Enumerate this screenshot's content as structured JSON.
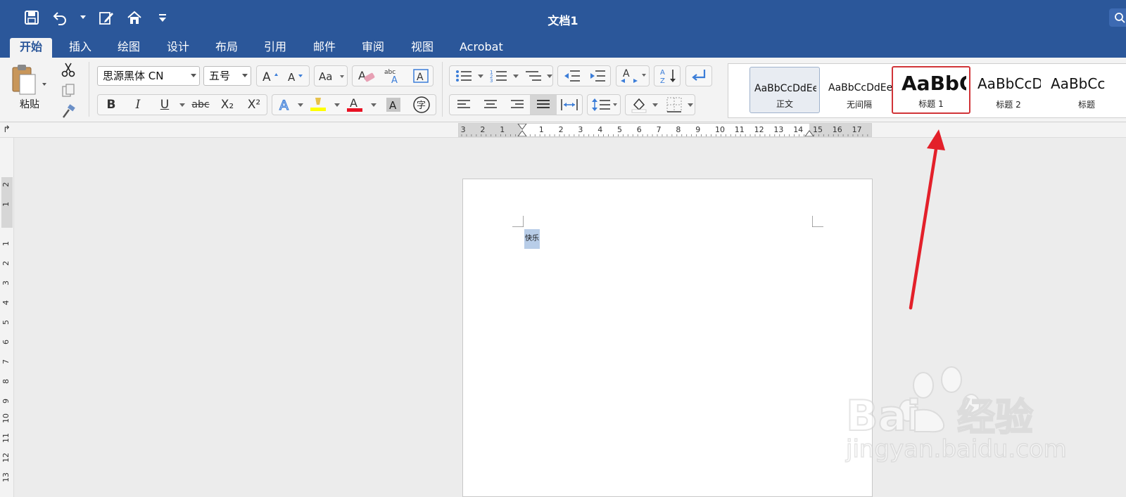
{
  "window": {
    "title": "文档1"
  },
  "tabs": [
    {
      "label": "开始",
      "active": true
    },
    {
      "label": "插入"
    },
    {
      "label": "绘图"
    },
    {
      "label": "设计"
    },
    {
      "label": "布局"
    },
    {
      "label": "引用"
    },
    {
      "label": "邮件"
    },
    {
      "label": "审阅"
    },
    {
      "label": "视图"
    },
    {
      "label": "Acrobat"
    }
  ],
  "clipboard": {
    "paste_label": "粘贴"
  },
  "font": {
    "name": "思源黑体 CN",
    "size": "五号",
    "bold": "B",
    "italic": "I",
    "underline": "U",
    "strike": "abc",
    "subscript": "X₂",
    "superscript": "X²",
    "highlight_color": "#ffff00",
    "font_color": "#e81123"
  },
  "styles": [
    {
      "preview": "AaBbCcDdEe",
      "name": "正文",
      "selected": true
    },
    {
      "preview": "AaBbCcDdEe",
      "name": "无间隔"
    },
    {
      "preview": "AaBbC",
      "name": "标题 1",
      "highlighted": true
    },
    {
      "preview": "AaBbCcD",
      "name": "标题 2"
    },
    {
      "preview": "AaBbCc",
      "name": "标题"
    }
  ],
  "ruler": {
    "h_labels": [
      "3",
      "2",
      "1",
      "1",
      "2",
      "3",
      "4",
      "5",
      "6",
      "7",
      "8",
      "9",
      "10",
      "11",
      "12",
      "13",
      "14",
      "15",
      "16",
      "17"
    ],
    "v_labels": [
      "2",
      "1",
      "1",
      "2",
      "3",
      "4",
      "5",
      "6",
      "7",
      "8",
      "9",
      "10",
      "11",
      "12",
      "13"
    ]
  },
  "document": {
    "selected_text": "快乐"
  },
  "watermark": {
    "brand": "Bai",
    "brand2": "经验",
    "url": "jingyan.baidu.com"
  },
  "colors": {
    "accent": "#2b579a",
    "annotation_arrow": "#e3202a",
    "selection": "#b8cde8"
  }
}
